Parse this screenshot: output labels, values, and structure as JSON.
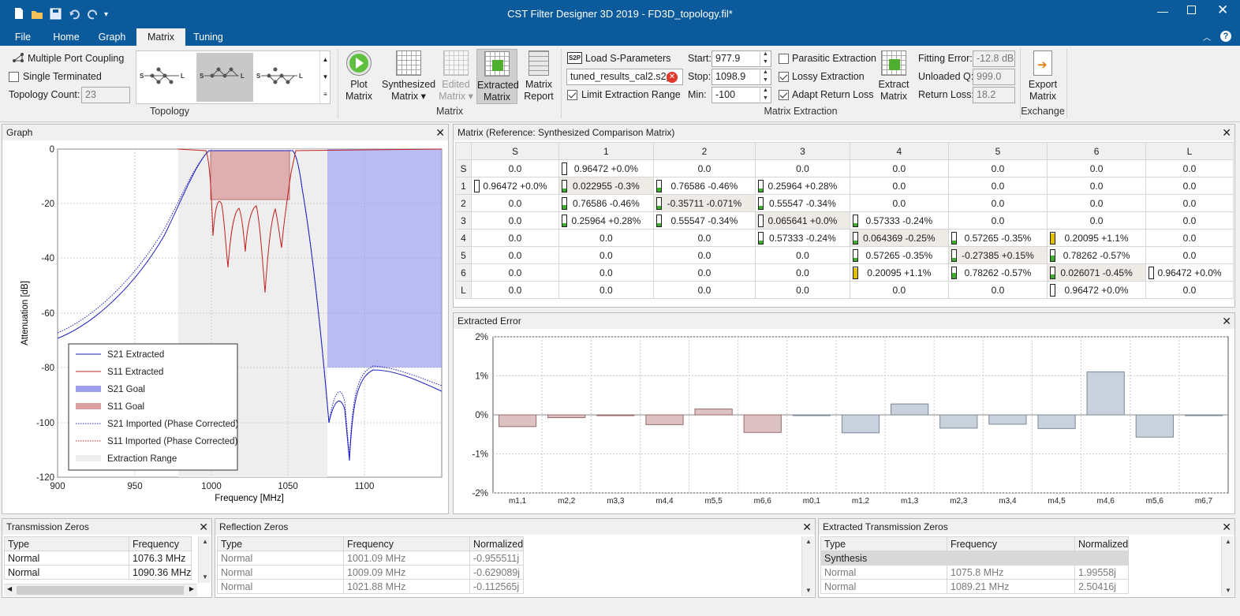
{
  "title": "CST Filter Designer 3D 2019 - FD3D_topology.fil*",
  "menu": [
    "File",
    "Home",
    "Graph",
    "Matrix",
    "Tuning"
  ],
  "ribbon": {
    "multiple_port": "Multiple Port Coupling",
    "single_terminated": "Single Terminated",
    "topology_count_label": "Topology Count:",
    "topology_count": "23",
    "topology_group": "Topology",
    "plot_matrix": [
      "Plot",
      "Matrix"
    ],
    "synth_matrix": [
      "Synthesized",
      "Matrix"
    ],
    "edited_matrix": [
      "Edited",
      "Matrix"
    ],
    "extracted_matrix": [
      "Extracted",
      "Matrix"
    ],
    "matrix_report": [
      "Matrix",
      "Report"
    ],
    "matrix_group": "Matrix",
    "load_s2p": "Load S-Parameters",
    "s2p_tag": "S2P",
    "filename": "tuned_results_cal2.s2p",
    "limit_range": "Limit Extraction Range",
    "start_label": "Start:",
    "start": "977.9",
    "stop_label": "Stop:",
    "stop": "1098.9",
    "min_label": "Min:",
    "min": "-100",
    "parasitic": "Parasitic Extraction",
    "lossy": "Lossy Extraction",
    "adapt_rl": "Adapt Return Loss",
    "extract_matrix": [
      "Extract",
      "Matrix"
    ],
    "fitting_error_label": "Fitting Error:",
    "fitting_error": "-12.8 dB",
    "unloaded_q_label": "Unloaded Q:",
    "unloaded_q": "999.0",
    "return_loss_label": "Return Loss:",
    "return_loss": "18.2",
    "extraction_group": "Matrix Extraction",
    "export_matrix": [
      "Export",
      "Matrix"
    ],
    "exchange_group": "Exchange"
  },
  "graph": {
    "title": "Graph",
    "xlabel": "Frequency [MHz]",
    "ylabel": "Attenuation [dB]",
    "xticks": [
      "900",
      "950",
      "1000",
      "1050",
      "1100"
    ],
    "yticks": [
      "0",
      "-20",
      "-40",
      "-60",
      "-80",
      "-100",
      "-120"
    ],
    "legend": [
      "S21 Extracted",
      "S11 Extracted",
      "S21 Goal",
      "S11 Goal",
      "S21 Imported (Phase Corrected)",
      "S11 Imported (Phase Corrected)",
      "Extraction Range"
    ]
  },
  "matrix": {
    "title": "Matrix (Reference: Synthesized Comparison Matrix)",
    "cols": [
      "S",
      "1",
      "2",
      "3",
      "4",
      "5",
      "6",
      "L"
    ],
    "rows": [
      {
        "h": "S",
        "c": [
          "0.0",
          "0.96472 +0.0%",
          "0.0",
          "0.0",
          "0.0",
          "0.0",
          "0.0",
          "0.0"
        ]
      },
      {
        "h": "1",
        "c": [
          "0.96472 +0.0%",
          "0.022955 -0.3%",
          "0.76586 -0.46%",
          "0.25964 +0.28%",
          "0.0",
          "0.0",
          "0.0",
          "0.0"
        ]
      },
      {
        "h": "2",
        "c": [
          "0.0",
          "0.76586 -0.46%",
          "-0.35711 -0.071%",
          "0.55547 -0.34%",
          "0.0",
          "0.0",
          "0.0",
          "0.0"
        ]
      },
      {
        "h": "3",
        "c": [
          "0.0",
          "0.25964 +0.28%",
          "0.55547 -0.34%",
          "0.065641 +0.0%",
          "0.57333 -0.24%",
          "0.0",
          "0.0",
          "0.0"
        ]
      },
      {
        "h": "4",
        "c": [
          "0.0",
          "0.0",
          "0.0",
          "0.57333 -0.24%",
          "0.064369 -0.25%",
          "0.57265 -0.35%",
          "0.20095 +1.1%",
          "0.0"
        ]
      },
      {
        "h": "5",
        "c": [
          "0.0",
          "0.0",
          "0.0",
          "0.0",
          "0.57265 -0.35%",
          "-0.27385 +0.15%",
          "0.78262 -0.57%",
          "0.0"
        ]
      },
      {
        "h": "6",
        "c": [
          "0.0",
          "0.0",
          "0.0",
          "0.0",
          "0.20095 +1.1%",
          "0.78262 -0.57%",
          "0.026071 -0.45%",
          "0.96472 +0.0%"
        ]
      },
      {
        "h": "L",
        "c": [
          "0.0",
          "0.0",
          "0.0",
          "0.0",
          "0.0",
          "0.0",
          "0.96472 +0.0%",
          "0.0"
        ]
      }
    ]
  },
  "chart_data": {
    "type": "bar",
    "title": "Extracted Error",
    "categories": [
      "m1,1",
      "m2,2",
      "m3,3",
      "m4,4",
      "m5,5",
      "m6,6",
      "m0,1",
      "m1,2",
      "m1,3",
      "m2,3",
      "m3,4",
      "m4,5",
      "m4,6",
      "m5,6",
      "m6,7"
    ],
    "values": [
      -0.3,
      -0.071,
      0.0,
      -0.25,
      0.15,
      -0.45,
      0.0,
      -0.46,
      0.28,
      -0.34,
      -0.24,
      -0.35,
      1.1,
      -0.57,
      0.0
    ],
    "yticks": [
      "2%",
      "1%",
      "0%",
      "-1%",
      "-2%"
    ],
    "ylim": [
      -2,
      2
    ],
    "colors": {
      "diagonal": "#dcc2c2",
      "offdiag": "#c9d2dc"
    }
  },
  "tz": {
    "title": "Transmission Zeros",
    "h": [
      "Type",
      "Frequency"
    ],
    "rows": [
      [
        "Normal",
        "1076.3 MHz"
      ],
      [
        "Normal",
        "1090.36 MHz"
      ]
    ]
  },
  "rz": {
    "title": "Reflection Zeros",
    "h": [
      "Type",
      "Frequency",
      "Normalized"
    ],
    "rows": [
      [
        "Normal",
        "1001.09 MHz",
        "-0.955511j"
      ],
      [
        "Normal",
        "1009.09 MHz",
        "-0.629089j"
      ],
      [
        "Normal",
        "1021.88 MHz",
        "-0.112565j"
      ]
    ]
  },
  "etz": {
    "title": "Extracted Transmission Zeros",
    "h": [
      "Type",
      "Frequency",
      "Normalized"
    ],
    "section": "Synthesis",
    "rows": [
      [
        "Normal",
        "1075.8 MHz",
        "1.99558j"
      ],
      [
        "Normal",
        "1089.21 MHz",
        "2.50416j"
      ]
    ]
  }
}
